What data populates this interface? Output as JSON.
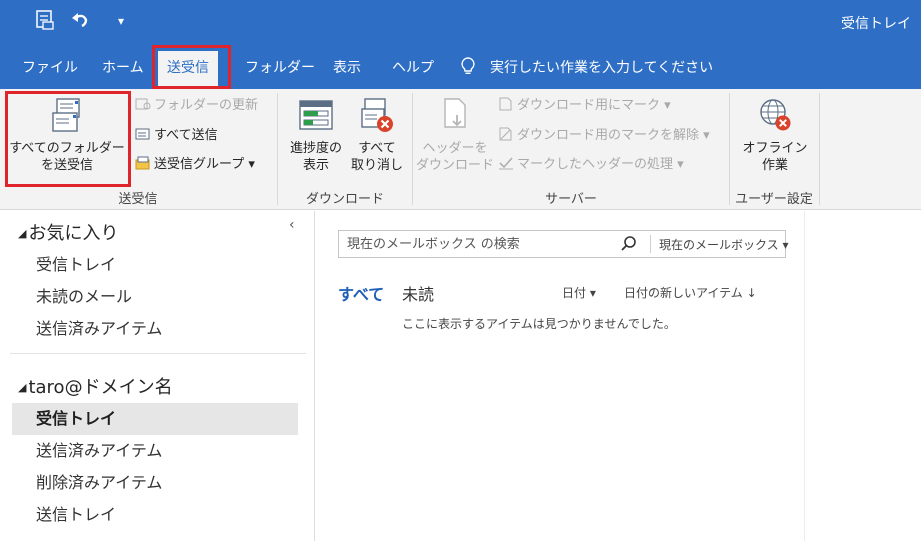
{
  "window": {
    "title": "受信トレイ"
  },
  "qat": {
    "sendreceive_icon": "send-receive-icon",
    "undo_icon": "undo-icon",
    "customize": "▾"
  },
  "tabs": [
    "ファイル",
    "ホーム",
    "送受信",
    "フォルダー",
    "表示",
    "ヘルプ"
  ],
  "active_tab": "送受信",
  "tell_me": {
    "icon": "lightbulb-icon",
    "placeholder": "実行したい作業を入力してください"
  },
  "ribbon": {
    "send_receive_all": "すべてのフォルダー\nを送受信",
    "update_folder": "フォルダーの更新",
    "send_all": "すべて送信",
    "send_receive_groups": "送受信グループ ▾",
    "group_send_receive": "送受信",
    "show_progress": "進捗度の\n表示",
    "cancel_all": "すべて\n取り消し",
    "group_download": "ダウンロード",
    "download_headers": "ヘッダーを\nダウンロード",
    "mark_to_download": "ダウンロード用にマーク ▾",
    "unmark_to_download": "ダウンロード用のマークを解除 ▾",
    "process_marked": "マークしたヘッダーの処理 ▾",
    "group_server": "サーバー",
    "work_offline": "オフライン\n作業",
    "group_preferences": "ユーザー設定"
  },
  "folder_pane": {
    "collapse": "‹",
    "favorites_header": "お気に入り",
    "favorites": [
      "受信トレイ",
      "未読のメール",
      "送信済みアイテム"
    ],
    "account_header": "taro@ドメイン名",
    "account_folders": [
      "受信トレイ",
      "送信済みアイテム",
      "削除済みアイテム",
      "送信トレイ"
    ],
    "selected": "受信トレイ"
  },
  "mail_list": {
    "search_placeholder": "現在のメールボックス の検索",
    "search_scope": "現在のメールボックス ▾",
    "filter_all": "すべて",
    "filter_unread": "未読",
    "sort_by": "日付 ▾",
    "sort_order": "日付の新しいアイテム ↓",
    "empty_message": "ここに表示するアイテムは見つかりませんでした。"
  },
  "colors": {
    "accent": "#2e6fc5",
    "highlight": "#e0242b",
    "link": "#1e5fb8"
  }
}
